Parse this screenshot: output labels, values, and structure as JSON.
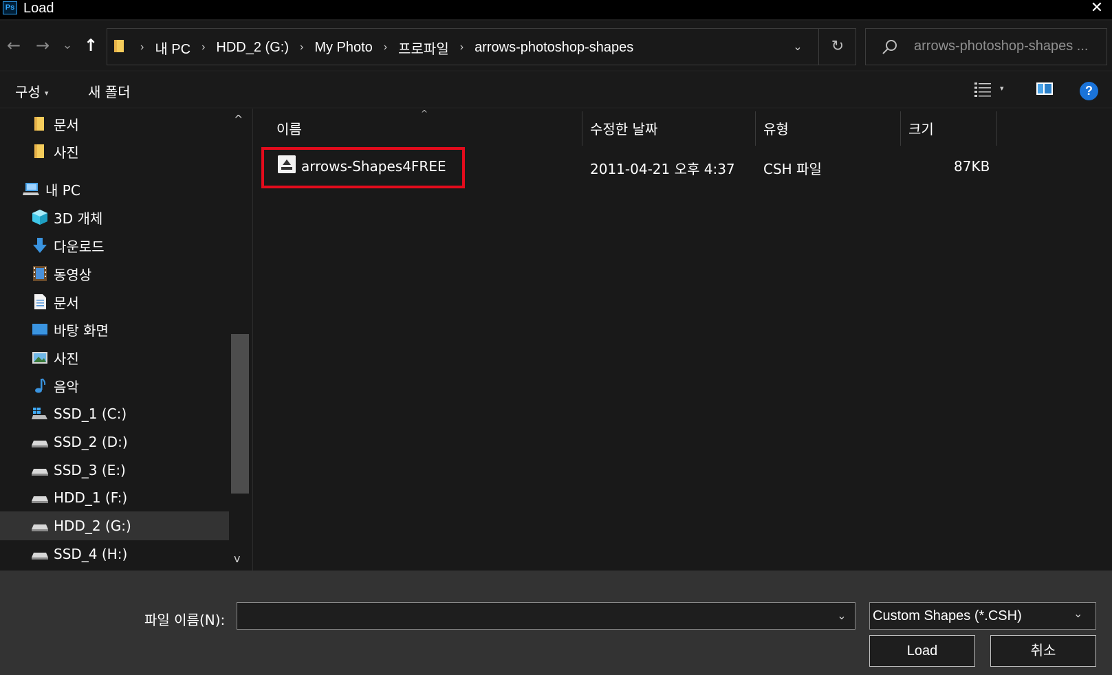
{
  "window": {
    "app_logo": "Ps",
    "title": "Load",
    "close_glyph": "✕"
  },
  "navigation": {
    "back": "←",
    "forward": "→",
    "recent": "⌄",
    "up": "↑"
  },
  "address": {
    "crumbs": [
      "내 PC",
      "HDD_2 (G:)",
      "My Photo",
      "프로파일",
      "arrows-photoshop-shapes"
    ],
    "separator": "›",
    "dropdown": "⌄",
    "refresh": "↻"
  },
  "search": {
    "placeholder": "arrows-photoshop-shapes ..."
  },
  "toolbar": {
    "organize": "구성",
    "organize_caret": "▾",
    "new_folder": "새 폴더",
    "view_caret": "▾",
    "help": "?"
  },
  "nav_pane": {
    "items": [
      {
        "label": "문서",
        "icon": "folder-icon"
      },
      {
        "label": "사진",
        "icon": "folder-icon"
      },
      {
        "label": "내 PC",
        "icon": "computer-icon"
      },
      {
        "label": "3D 개체",
        "icon": "cube-3d-icon"
      },
      {
        "label": "다운로드",
        "icon": "download-arrow-icon"
      },
      {
        "label": "동영상",
        "icon": "film-icon"
      },
      {
        "label": "문서",
        "icon": "document-icon"
      },
      {
        "label": "바탕 화면",
        "icon": "desktop-icon"
      },
      {
        "label": "사진",
        "icon": "picture-icon"
      },
      {
        "label": "음악",
        "icon": "music-note-icon"
      },
      {
        "label": "SSD_1 (C:)",
        "icon": "windows-drive-icon"
      },
      {
        "label": "SSD_2 (D:)",
        "icon": "drive-icon"
      },
      {
        "label": "SSD_3 (E:)",
        "icon": "drive-icon"
      },
      {
        "label": "HDD_1 (F:)",
        "icon": "drive-icon"
      },
      {
        "label": "HDD_2 (G:)",
        "icon": "drive-icon",
        "selected": true
      },
      {
        "label": "SSD_4 (H:)",
        "icon": "drive-icon"
      }
    ],
    "scroll_up": "^",
    "scroll_down": "v"
  },
  "file_list": {
    "columns": [
      "이름",
      "수정한 날짜",
      "유형",
      "크기"
    ],
    "sort_indicator": "^",
    "rows": [
      {
        "name": "arrows-Shapes4FREE",
        "modified": "2011-04-21 오후 4:37",
        "type": "CSH 파일",
        "size": "87KB",
        "highlighted": true
      }
    ]
  },
  "footer": {
    "file_name_label": "파일 이름(N):",
    "file_name_value": "",
    "file_name_dropdown": "⌄",
    "file_type": "Custom Shapes (*.CSH)",
    "file_type_dropdown": "⌄",
    "load_button": "Load",
    "cancel_button": "취소"
  },
  "colors": {
    "background": "#191919",
    "footer_background": "#333333",
    "highlight_border": "#e30b1c",
    "help_blue": "#1a73d9",
    "ps_blue": "#31a8ff"
  }
}
